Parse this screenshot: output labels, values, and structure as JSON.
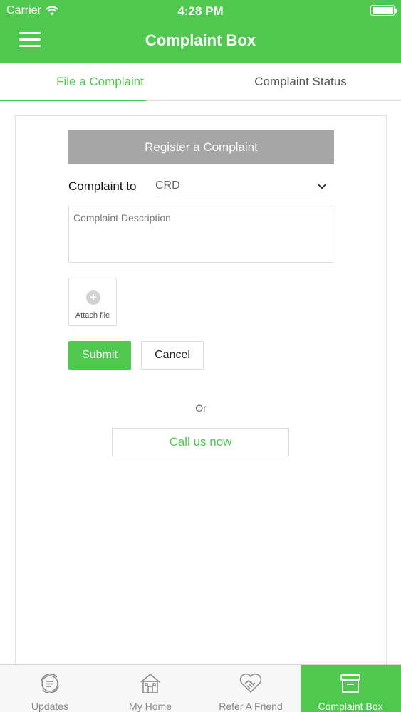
{
  "status_bar": {
    "carrier": "Carrier",
    "time": "4:28 PM"
  },
  "nav": {
    "title": "Complaint Box"
  },
  "tabs": [
    {
      "label": "File a Complaint",
      "active": true
    },
    {
      "label": "Complaint Status",
      "active": false
    }
  ],
  "form": {
    "header": "Register a Complaint",
    "complaint_to_label": "Complaint to",
    "complaint_to_value": "CRD",
    "description_placeholder": "Complaint Description",
    "description_value": "",
    "attach_label": "Attach file",
    "submit_label": "Submit",
    "cancel_label": "Cancel",
    "or_text": "Or",
    "call_label": "Call us now"
  },
  "bottom_tabs": [
    {
      "label": "Updates",
      "icon": "updates-icon",
      "active": false
    },
    {
      "label": "My Home",
      "icon": "home-icon",
      "active": false
    },
    {
      "label": "Refer A Friend",
      "icon": "handshake-icon",
      "active": false
    },
    {
      "label": "Complaint Box",
      "icon": "box-icon",
      "active": true
    }
  ],
  "colors": {
    "accent": "#4fc84f",
    "header_gray": "#a6a6a6"
  }
}
